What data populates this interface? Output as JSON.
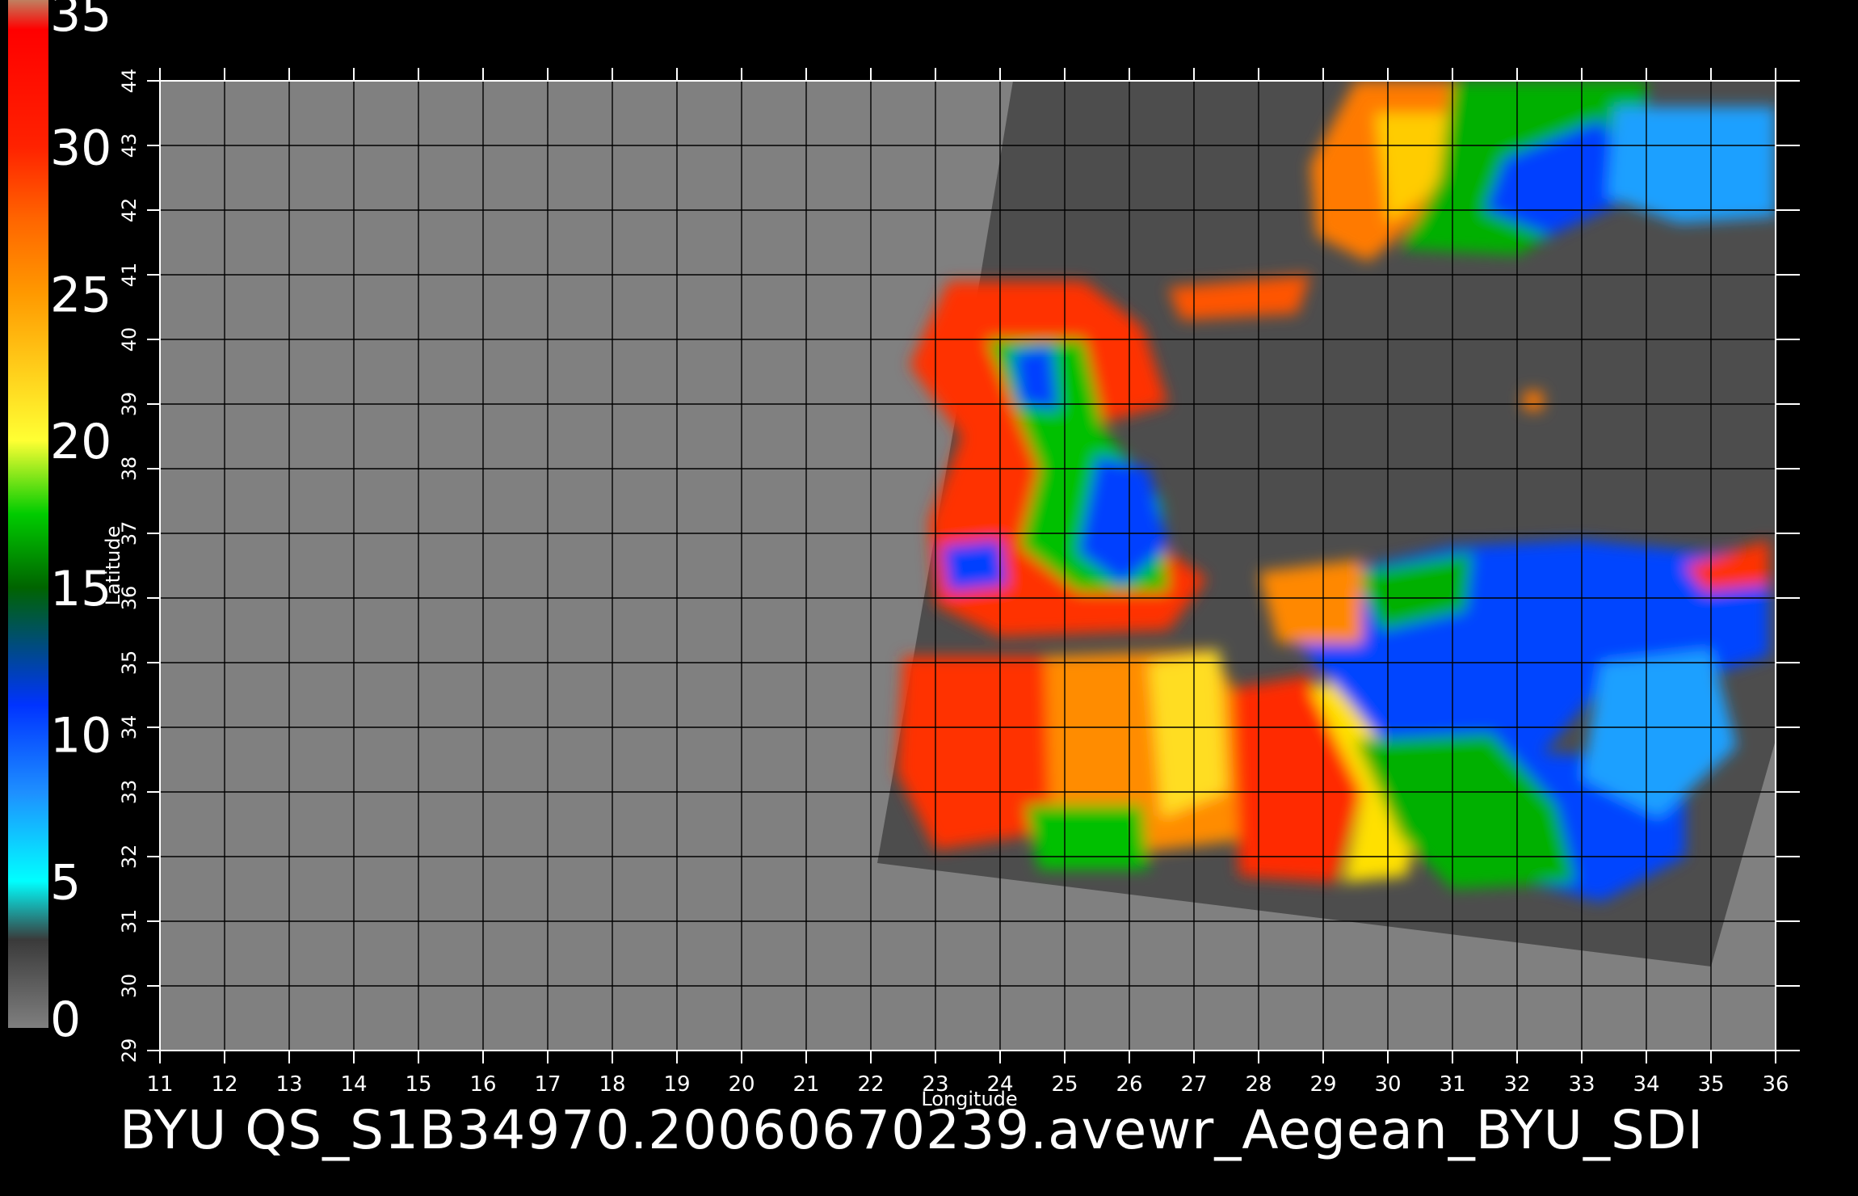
{
  "colorbar": {
    "ticks": [
      "0",
      "5",
      "10",
      "15",
      "20",
      "25",
      "30",
      "35"
    ],
    "min": 0,
    "max": 35,
    "stops": [
      {
        "v": 0,
        "c": "#7f7f7f"
      },
      {
        "v": 3,
        "c": "#3a3a3a"
      },
      {
        "v": 5,
        "c": "#00ffff"
      },
      {
        "v": 8,
        "c": "#1e90ff"
      },
      {
        "v": 11,
        "c": "#0033ff"
      },
      {
        "v": 15,
        "c": "#006400"
      },
      {
        "v": 17.5,
        "c": "#00cc00"
      },
      {
        "v": 20,
        "c": "#ffff33"
      },
      {
        "v": 25,
        "c": "#ff9900"
      },
      {
        "v": 27.5,
        "c": "#ff6600"
      },
      {
        "v": 30,
        "c": "#ff2200"
      },
      {
        "v": 34,
        "c": "#ff0000"
      },
      {
        "v": 35,
        "c": "#c08060"
      }
    ]
  },
  "map": {
    "lon_range": [
      11,
      36
    ],
    "lat_range": [
      29,
      44
    ],
    "lon_ticks": [
      "11",
      "12",
      "13",
      "14",
      "15",
      "16",
      "17",
      "18",
      "19",
      "20",
      "21",
      "22",
      "23",
      "24",
      "25",
      "26",
      "27",
      "28",
      "29",
      "30",
      "31",
      "32",
      "33",
      "34",
      "35",
      "36"
    ],
    "lat_ticks": [
      "29",
      "30",
      "31",
      "32",
      "33",
      "34",
      "35",
      "36",
      "37",
      "38",
      "39",
      "40",
      "41",
      "42",
      "43",
      "44"
    ],
    "xlabel": "Longitude",
    "ylabel": "Latitude",
    "background_color": "#808080",
    "swath_color": "#4d4d4d",
    "grid_color": "#000000"
  },
  "caption": "BYU  QS_S1B34970.20060670239.avewr_Aegean_BYU_SDI"
}
